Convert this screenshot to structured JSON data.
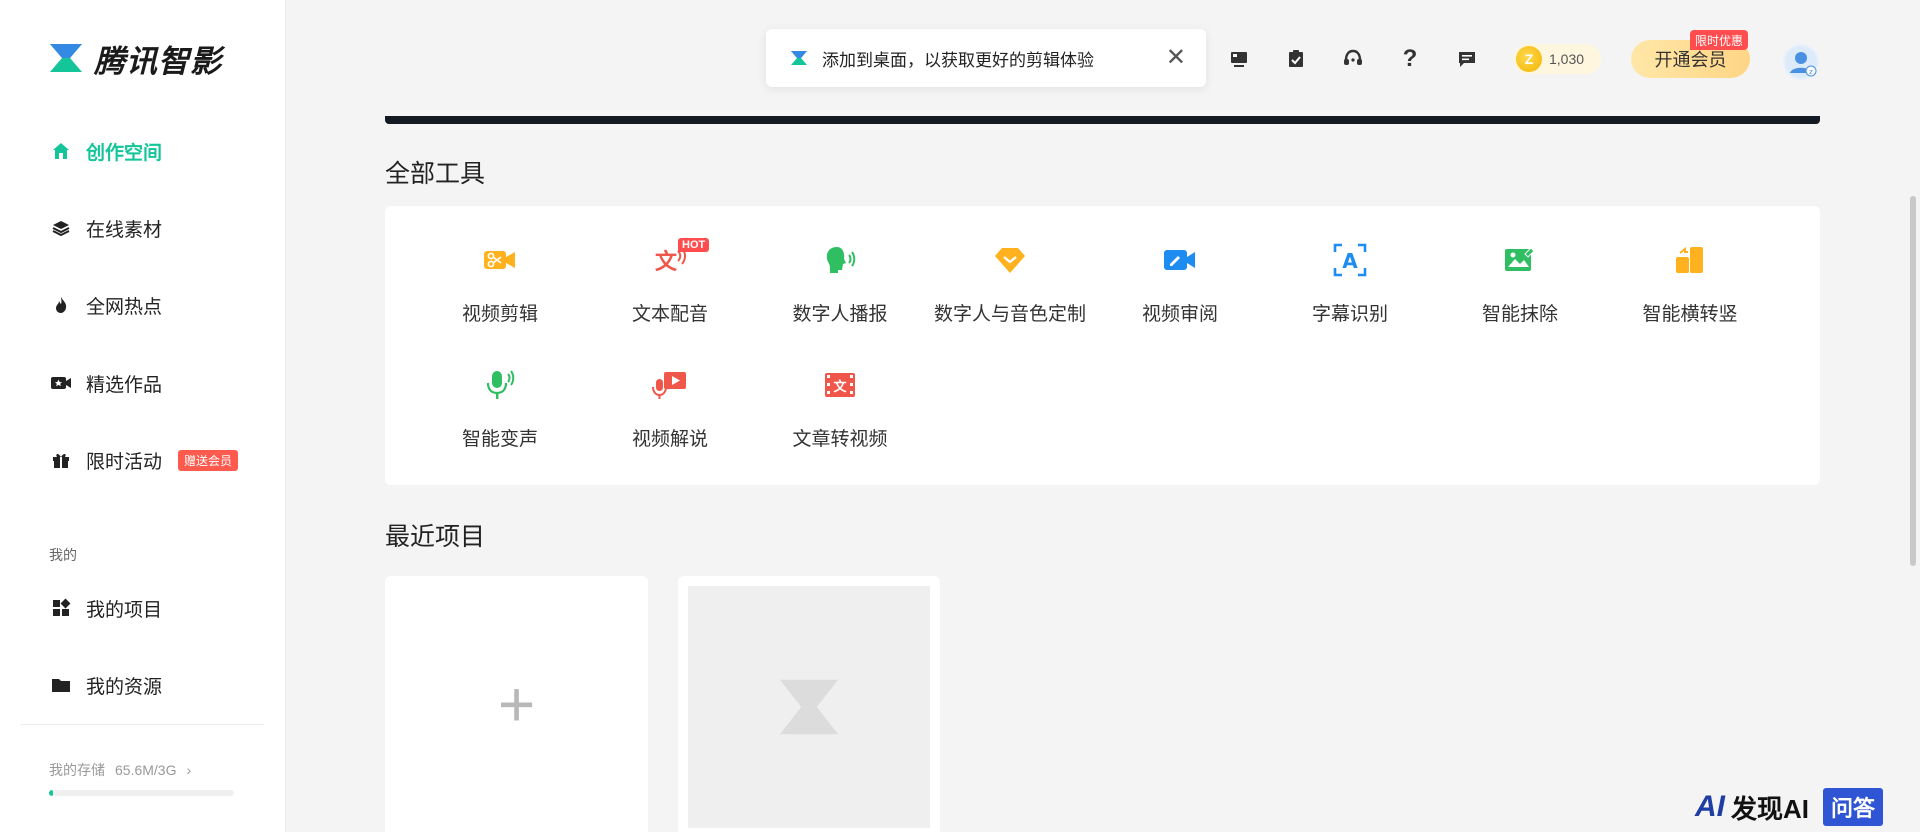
{
  "brand": {
    "name": "腾讯智影",
    "accent": "#14c59a"
  },
  "sidebar": {
    "items": [
      {
        "label": "创作空间",
        "icon": "home-icon",
        "active": true
      },
      {
        "label": "在线素材",
        "icon": "layers-icon"
      },
      {
        "label": "全网热点",
        "icon": "flame-icon"
      },
      {
        "label": "精选作品",
        "icon": "star-video-icon"
      },
      {
        "label": "限时活动",
        "icon": "gift-icon",
        "badge": "赠送会员"
      }
    ],
    "section_label": "我的",
    "my_items": [
      {
        "label": "我的项目",
        "icon": "grid-icon"
      },
      {
        "label": "我的资源",
        "icon": "folder-icon"
      }
    ],
    "storage": {
      "label": "我的存储",
      "value": "65.6M/3G",
      "fraction": 0.02
    }
  },
  "header": {
    "toast_text": "添加到桌面，以获取更好的剪辑体验",
    "coins": "1,030",
    "vip_label": "开通会员",
    "vip_badge": "限时优惠",
    "icons": [
      "desktop-icon",
      "checklist-icon",
      "headset-icon",
      "help-icon",
      "message-icon"
    ]
  },
  "tools": {
    "title": "全部工具",
    "hot_label": "HOT",
    "items": [
      {
        "label": "视频剪辑",
        "icon": "scissors-video-icon",
        "color": "#ffb21e"
      },
      {
        "label": "文本配音",
        "icon": "text-voice-icon",
        "color": "#f0564a",
        "hot": true
      },
      {
        "label": "数字人播报",
        "icon": "digital-human-icon",
        "color": "#2fbf62"
      },
      {
        "label": "数字人与音色定制",
        "icon": "diamond-custom-icon",
        "color": "#ffb21e"
      },
      {
        "label": "视频审阅",
        "icon": "video-review-icon",
        "color": "#1e8cf0"
      },
      {
        "label": "字幕识别",
        "icon": "subtitle-recognition-icon",
        "color": "#1e8cf0"
      },
      {
        "label": "智能抹除",
        "icon": "smart-erase-icon",
        "color": "#2fbf62"
      },
      {
        "label": "智能横转竖",
        "icon": "landscape-portrait-icon",
        "color": "#ffb21e"
      },
      {
        "label": "智能变声",
        "icon": "voice-change-icon",
        "color": "#2fbf62"
      },
      {
        "label": "视频解说",
        "icon": "video-narration-icon",
        "color": "#f0564a"
      },
      {
        "label": "文章转视频",
        "icon": "article-to-video-icon",
        "color": "#f0564a"
      }
    ]
  },
  "recent": {
    "title": "最近项目"
  },
  "watermark": {
    "ai": "AI",
    "text": "发现AI",
    "qa": "问答"
  }
}
